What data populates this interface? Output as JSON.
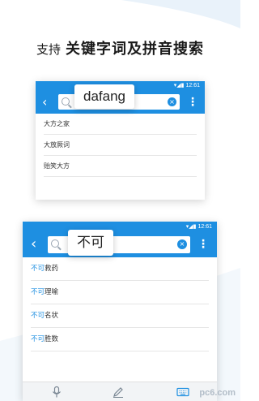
{
  "headline": {
    "prefix": "支持",
    "main": "关键字词及拼音搜索"
  },
  "screen1": {
    "status_time": "12:61",
    "query": "dafang",
    "results": [
      "大方之家",
      "大放厥词",
      "贻笑大方"
    ]
  },
  "screen2": {
    "status_time": "12:61",
    "query": "不可",
    "results": [
      {
        "hl": "不可",
        "rest": "救药"
      },
      {
        "hl": "不可",
        "rest": "理喻"
      },
      {
        "hl": "不可",
        "rest": "名状"
      },
      {
        "hl": "不可",
        "rest": "胜数"
      }
    ]
  },
  "watermark": "pc6.com",
  "colors": {
    "accent": "#1e8fe1"
  },
  "icons": {
    "back": "back-arrow-icon",
    "search": "search-icon",
    "clear": "clear-icon",
    "more": "more-vertical-icon",
    "mic": "microphone-icon",
    "pen": "pen-icon",
    "keyboard": "keyboard-icon"
  }
}
